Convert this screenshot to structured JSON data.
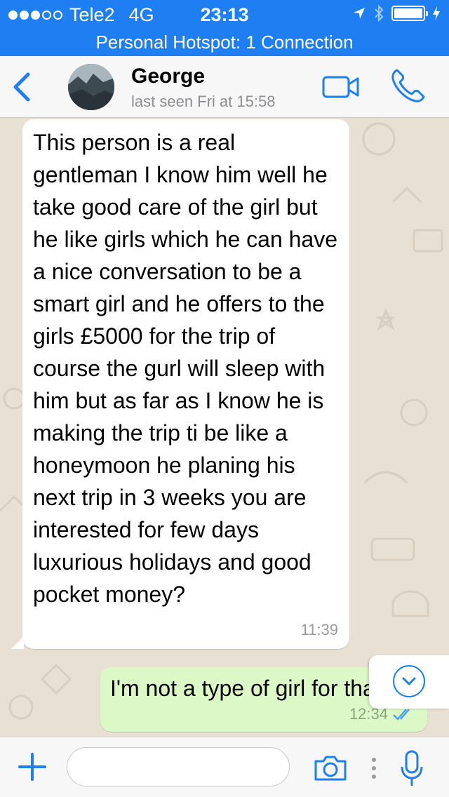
{
  "status_bar": {
    "carrier": "Tele2",
    "network": "4G",
    "time": "23:13",
    "signal_bars_filled": 3,
    "signal_bars_total": 5
  },
  "hotspot_banner": "Personal Hotspot: 1 Connection",
  "header": {
    "back_icon": "chevron-left-icon",
    "contact_name": "George",
    "last_seen": "last seen Fri at 15:58",
    "video_icon": "video-camera-icon",
    "call_icon": "phone-icon"
  },
  "messages": [
    {
      "direction": "incoming",
      "text": "This person is a real gentleman I know him well he take good care of the girl but he like girls which he can have a nice conversation to be a smart girl and he offers to the girls £5000 for the trip of course the gurl will sleep with him but as far as I know he is making the trip ti be like a honeymoon he planing his next trip in 3 weeks you are interested for few days luxurious holidays and good pocket money?",
      "time": "11:39"
    },
    {
      "direction": "outgoing",
      "text": "I'm not a type of girl for tha",
      "time": "12:34",
      "status_icon": "double-check-read-icon"
    }
  ],
  "input_bar": {
    "value": "",
    "placeholder": ""
  },
  "colors": {
    "ios_blue": "#1e7ef2",
    "incoming_bubble": "#ffffff",
    "outgoing_bubble": "#dcf8c6",
    "chat_background": "#e8e0d3"
  }
}
